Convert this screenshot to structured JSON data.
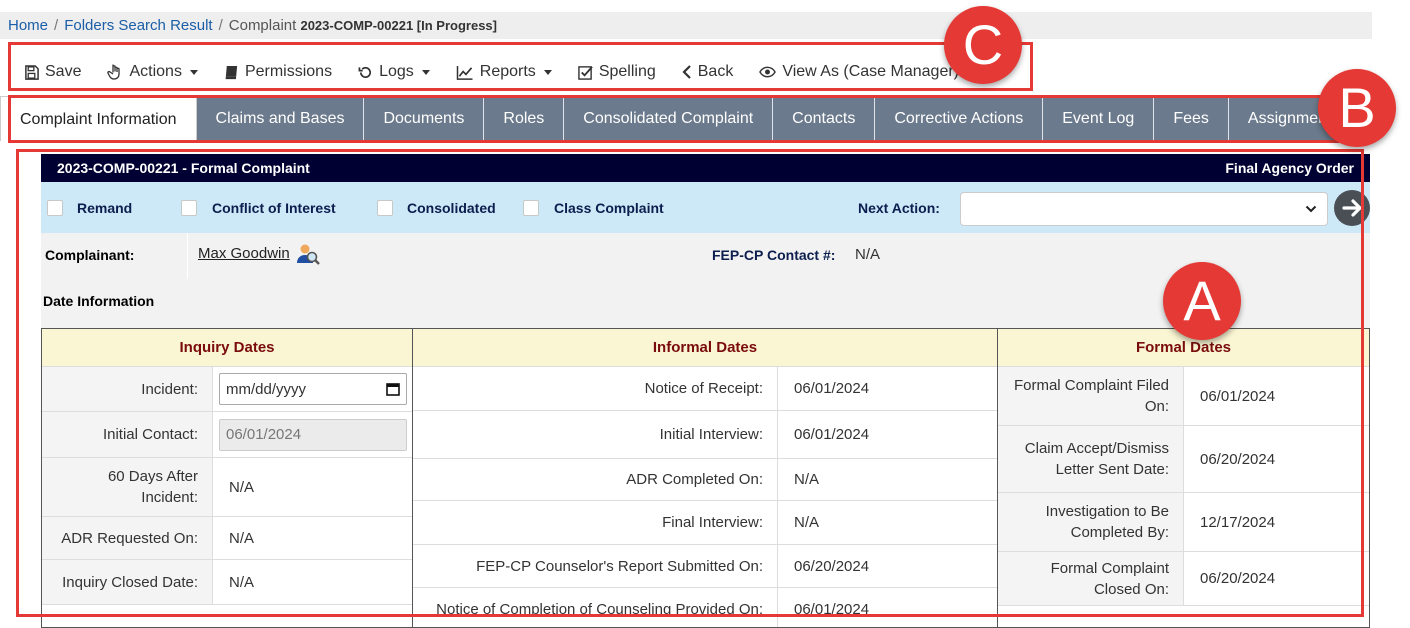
{
  "breadcrumb": {
    "home": "Home",
    "folders": "Folders Search Result",
    "current_prefix": "Complaint",
    "current_id": "2023-COMP-00221 [In Progress]"
  },
  "toolbar": {
    "save": "Save",
    "actions": "Actions",
    "permissions": "Permissions",
    "logs": "Logs",
    "reports": "Reports",
    "spelling": "Spelling",
    "back": "Back",
    "view_as": "View As (Case Manager)"
  },
  "tabs": [
    {
      "label": "Complaint Information",
      "active": true
    },
    {
      "label": "Claims and Bases"
    },
    {
      "label": "Documents"
    },
    {
      "label": "Roles"
    },
    {
      "label": "Consolidated Complaint"
    },
    {
      "label": "Contacts"
    },
    {
      "label": "Corrective Actions"
    },
    {
      "label": "Event Log"
    },
    {
      "label": "Fees"
    },
    {
      "label": "Assignments"
    }
  ],
  "header": {
    "title": "2023-COMP-00221 - Formal Complaint",
    "status": "Final Agency Order"
  },
  "flags": {
    "remand": "Remand",
    "conflict": "Conflict of Interest",
    "consolidated": "Consolidated",
    "class_complaint": "Class Complaint",
    "next_action_label": "Next Action:",
    "next_action_value": ""
  },
  "complainant": {
    "label": "Complainant:",
    "name": "Max Goodwin",
    "fep_label": "FEP-CP Contact #:",
    "fep_value": "N/A"
  },
  "date_info": {
    "label": "Date Information"
  },
  "inquiry": {
    "title": "Inquiry Dates",
    "rows": [
      {
        "label": "Incident:",
        "value": "mm/dd/yyyy"
      },
      {
        "label": "Initial Contact:",
        "value": "06/01/2024"
      },
      {
        "label": "60 Days After Incident:",
        "value": "N/A"
      },
      {
        "label": "ADR Requested On:",
        "value": "N/A"
      },
      {
        "label": "Inquiry Closed Date:",
        "value": "N/A"
      }
    ]
  },
  "informal": {
    "title": "Informal Dates",
    "rows": [
      {
        "label": "Notice of Receipt:",
        "value": "06/01/2024"
      },
      {
        "label": "Initial Interview:",
        "value": "06/01/2024"
      },
      {
        "label": "ADR Completed On:",
        "value": "N/A"
      },
      {
        "label": "Final Interview:",
        "value": "N/A"
      },
      {
        "label": "FEP-CP Counselor's Report Submitted On:",
        "value": "06/20/2024"
      },
      {
        "label": "Notice of Completion of Counseling Provided On:",
        "value": "06/01/2024"
      }
    ]
  },
  "formal": {
    "title": "Formal Dates",
    "rows": [
      {
        "label": "Formal Complaint Filed On:",
        "value": "06/01/2024"
      },
      {
        "label": "Claim Accept/Dismiss Letter Sent Date:",
        "value": "06/20/2024"
      },
      {
        "label": "Investigation to Be Completed By:",
        "value": "12/17/2024"
      },
      {
        "label": "Formal Complaint Closed On:",
        "value": "06/20/2024"
      }
    ]
  },
  "annotations": {
    "a": "A",
    "b": "B",
    "c": "C"
  },
  "colors": {
    "accent_red": "#e53935",
    "header_navy": "#000033",
    "tab_gray": "#6b7a8c",
    "panel_title": "#7a0c0c"
  }
}
